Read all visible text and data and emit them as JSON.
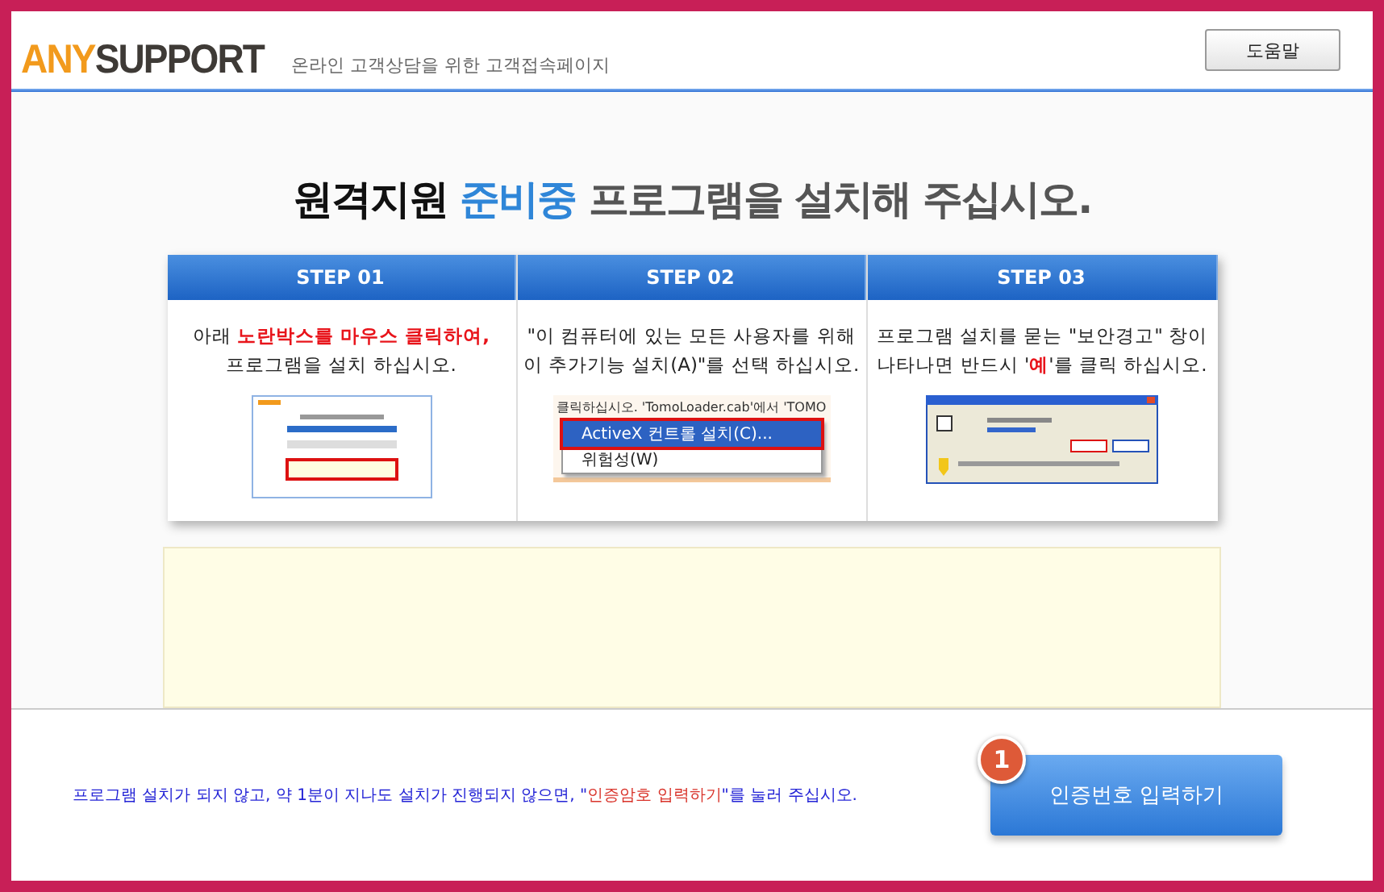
{
  "header": {
    "logo": [
      {
        "text": "ANY",
        "color": "#f29a1c"
      },
      {
        "text": "SUPPORT",
        "color": "#3e3a36"
      }
    ],
    "subtitle": "온라인 고객상담을 위한 고객접속페이지",
    "help_button": "도움말"
  },
  "headline": [
    {
      "text": "원격지원 ",
      "color": "#111111"
    },
    {
      "text": "준비중",
      "color": "#2f86d8"
    },
    {
      "text": " 프로그램을 설치해 주십시오.",
      "color": "#555555"
    }
  ],
  "steps": [
    {
      "title": "STEP 01",
      "kind": "page",
      "lines": [
        [
          {
            "text": "아래 ",
            "highlight": false
          },
          {
            "text": "노란박스를 마우스 클릭하여,",
            "highlight": true
          }
        ],
        [
          {
            "text": "프로그램을 설치 하십시오.",
            "highlight": false
          }
        ]
      ]
    },
    {
      "title": "STEP 02",
      "kind": "menu",
      "lines": [
        [
          {
            "text": "\"이 컴퓨터에 있는 모든 사용자를 위해",
            "highlight": false
          }
        ],
        [
          {
            "text": "이 추가기능 설치(A)\"를 선택 하십시오.",
            "highlight": false
          }
        ]
      ],
      "menu": {
        "caption": "클릭하십시오. 'TomoLoader.cab'에서 'TOMO",
        "items": [
          {
            "label": "ActiveX 컨트롤 설치(C)...",
            "selected": true
          },
          {
            "label": "위험성(W)",
            "selected": false
          }
        ]
      }
    },
    {
      "title": "STEP 03",
      "kind": "dialog",
      "lines": [
        [
          {
            "text": "프로그램 설치를 묻는 \"보안경고\" 창이",
            "highlight": false
          }
        ],
        [
          {
            "text": "나타나면 반드시 '",
            "highlight": false
          },
          {
            "text": "예",
            "highlight": true
          },
          {
            "text": "'를 클릭 하십시오.",
            "highlight": false
          }
        ]
      ]
    }
  ],
  "footer": {
    "notice": [
      {
        "text": "프로그램 설치가 되지 않고, 약 1분이 지나도 설치가 진행되지 않으면, \"",
        "highlight": false
      },
      {
        "text": "인증암호 입력하기",
        "highlight": true
      },
      {
        "text": "\"를 눌러 주십시오.",
        "highlight": false
      }
    ],
    "badge": "1",
    "button": "인증번호 입력하기"
  }
}
